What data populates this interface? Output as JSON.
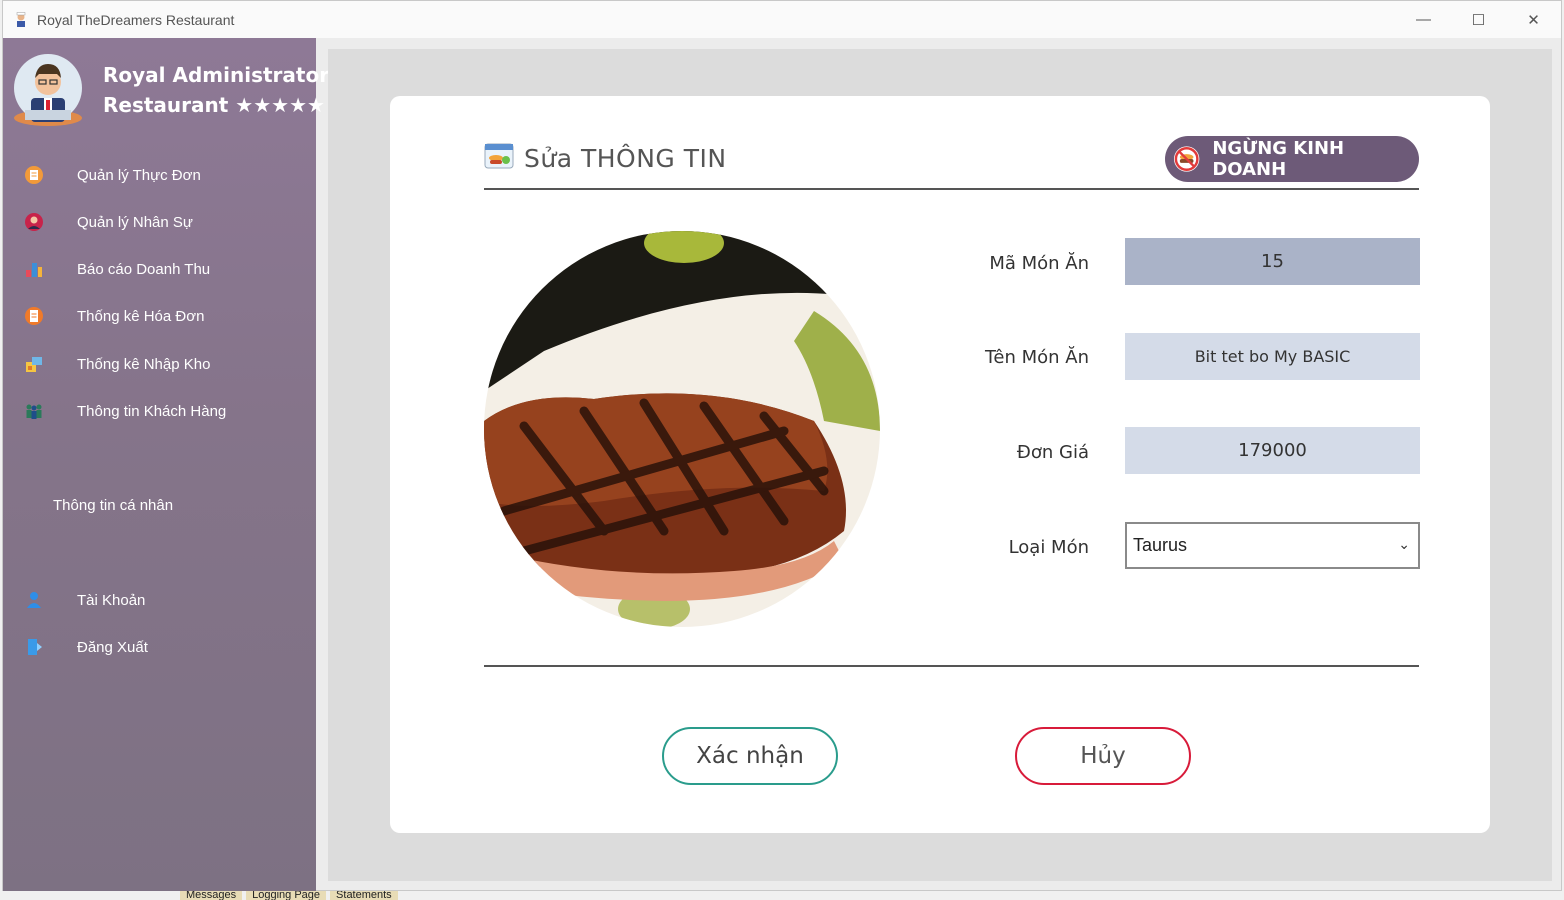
{
  "window": {
    "title": "Royal TheDreamers Restaurant",
    "controls": {
      "minimize": "—",
      "maximize": "☐",
      "close": "✕"
    }
  },
  "sidebar": {
    "brand_line1": "Royal Administrator",
    "brand_line2": "Restaurant ★★★★★",
    "items": [
      {
        "label": "Quản lý Thực Đơn",
        "icon": "menu-icon"
      },
      {
        "label": "Quản lý Nhân Sự",
        "icon": "staff-icon"
      },
      {
        "label": "Báo cáo Doanh Thu",
        "icon": "revenue-chart-icon"
      },
      {
        "label": "Thống kê Hóa Đơn",
        "icon": "invoice-icon"
      },
      {
        "label": "Thống kê Nhập Kho",
        "icon": "warehouse-icon"
      },
      {
        "label": "Thông tin Khách Hàng",
        "icon": "customers-icon"
      }
    ],
    "section_personal": "Thông tin cá nhân",
    "account_items": [
      {
        "label": "Tài Khoản",
        "icon": "user-icon"
      },
      {
        "label": "Đăng Xuất",
        "icon": "logout-icon"
      }
    ]
  },
  "form": {
    "title": "Sửa THÔNG TIN",
    "stop_button": "NGỪNG KINH DOANH",
    "fields": {
      "ma_mon_an": {
        "label": "Mã Món Ăn",
        "value": "15"
      },
      "ten_mon_an": {
        "label": "Tên Món Ăn",
        "value": "Bit tet bo My BASIC"
      },
      "don_gia": {
        "label": "Đơn Giá",
        "value": "179000"
      },
      "loai_mon": {
        "label": "Loại Món",
        "value": "Taurus"
      }
    },
    "confirm_button": "Xác nhận",
    "cancel_button": "Hủy"
  },
  "colors": {
    "sidebar": "#85748a",
    "accent_purple": "#6d5a78",
    "confirm_border": "#2a9c8c",
    "cancel_border": "#d81b3a",
    "readonly_field": "#aab3c8",
    "editable_field": "#d4dbe8"
  },
  "taskbar": [
    "Messages",
    "Logging Page",
    "Statements"
  ]
}
